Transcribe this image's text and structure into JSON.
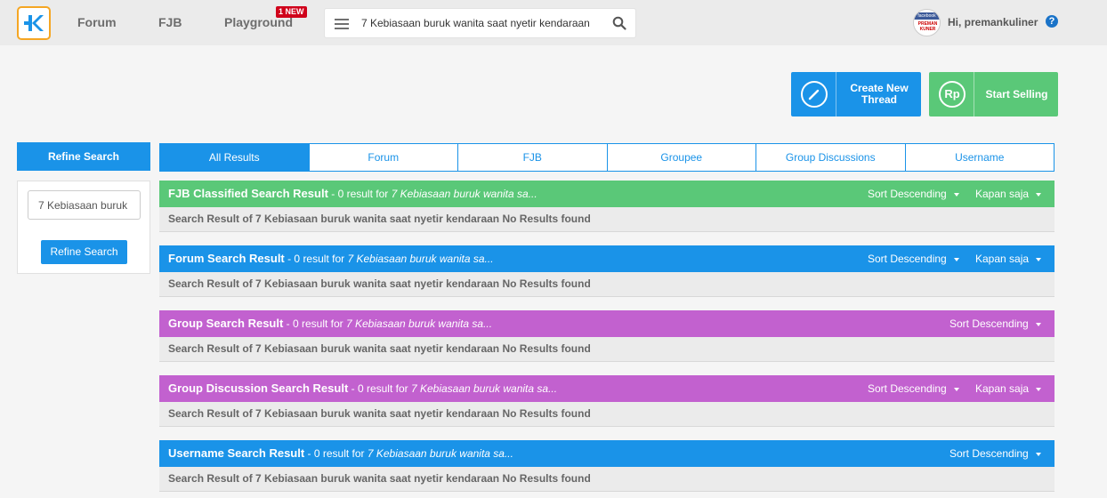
{
  "nav": {
    "links": [
      "Forum",
      "FJB",
      "Playground"
    ],
    "badge": "1 NEW",
    "search_value": "7 Kebiasaan buruk wanita saat nyetir kendaraan",
    "username": "Hi, premankuliner",
    "avatar_text_top": "facebook",
    "avatar_text_bottom": "PREMAN KUNER",
    "help_label": "?"
  },
  "actions": {
    "create_line1": "Create New",
    "create_line2": "Thread",
    "sell_label": "Start Selling",
    "sell_icon": "Rp"
  },
  "sidebar": {
    "header": "Refine Search",
    "input_value": "7 Kebiasaan buruk",
    "button": "Refine Search"
  },
  "tabs": [
    "All Results",
    "Forum",
    "FJB",
    "Groupee",
    "Group Discussions",
    "Username"
  ],
  "sections": [
    {
      "title": "FJB Classified Search Result",
      "count_text": " - 0 result for ",
      "query": "7 Kebiasaan buruk wanita sa...",
      "sort": "Sort Descending",
      "time": "Kapan saja",
      "body": "Search Result of 7 Kebiasaan buruk wanita saat nyetir kendaraan No Results found",
      "color": "#5ac878"
    },
    {
      "title": "Forum Search Result",
      "count_text": " - 0 result for ",
      "query": "7 Kebiasaan buruk wanita sa...",
      "sort": "Sort Descending",
      "time": "Kapan saja",
      "body": "Search Result of 7 Kebiasaan buruk wanita saat nyetir kendaraan No Results found",
      "color": "#1a93e8"
    },
    {
      "title": "Group Search Result",
      "count_text": " - 0 result for ",
      "query": "7 Kebiasaan buruk wanita sa...",
      "sort": "Sort Descending",
      "body": "Search Result of 7 Kebiasaan buruk wanita saat nyetir kendaraan No Results found",
      "color": "#c261cf"
    },
    {
      "title": "Group Discussion Search Result",
      "count_text": " - 0 result for ",
      "query": "7 Kebiasaan buruk wanita sa...",
      "sort": "Sort Descending",
      "time": "Kapan saja",
      "body": "Search Result of 7 Kebiasaan buruk wanita saat nyetir kendaraan No Results found",
      "color": "#c261cf"
    },
    {
      "title": "Username Search Result",
      "count_text": " - 0 result for ",
      "query": "7 Kebiasaan buruk wanita sa...",
      "sort": "Sort Descending",
      "body": "Search Result of 7 Kebiasaan buruk wanita saat nyetir kendaraan No Results found",
      "color": "#1a93e8"
    }
  ]
}
